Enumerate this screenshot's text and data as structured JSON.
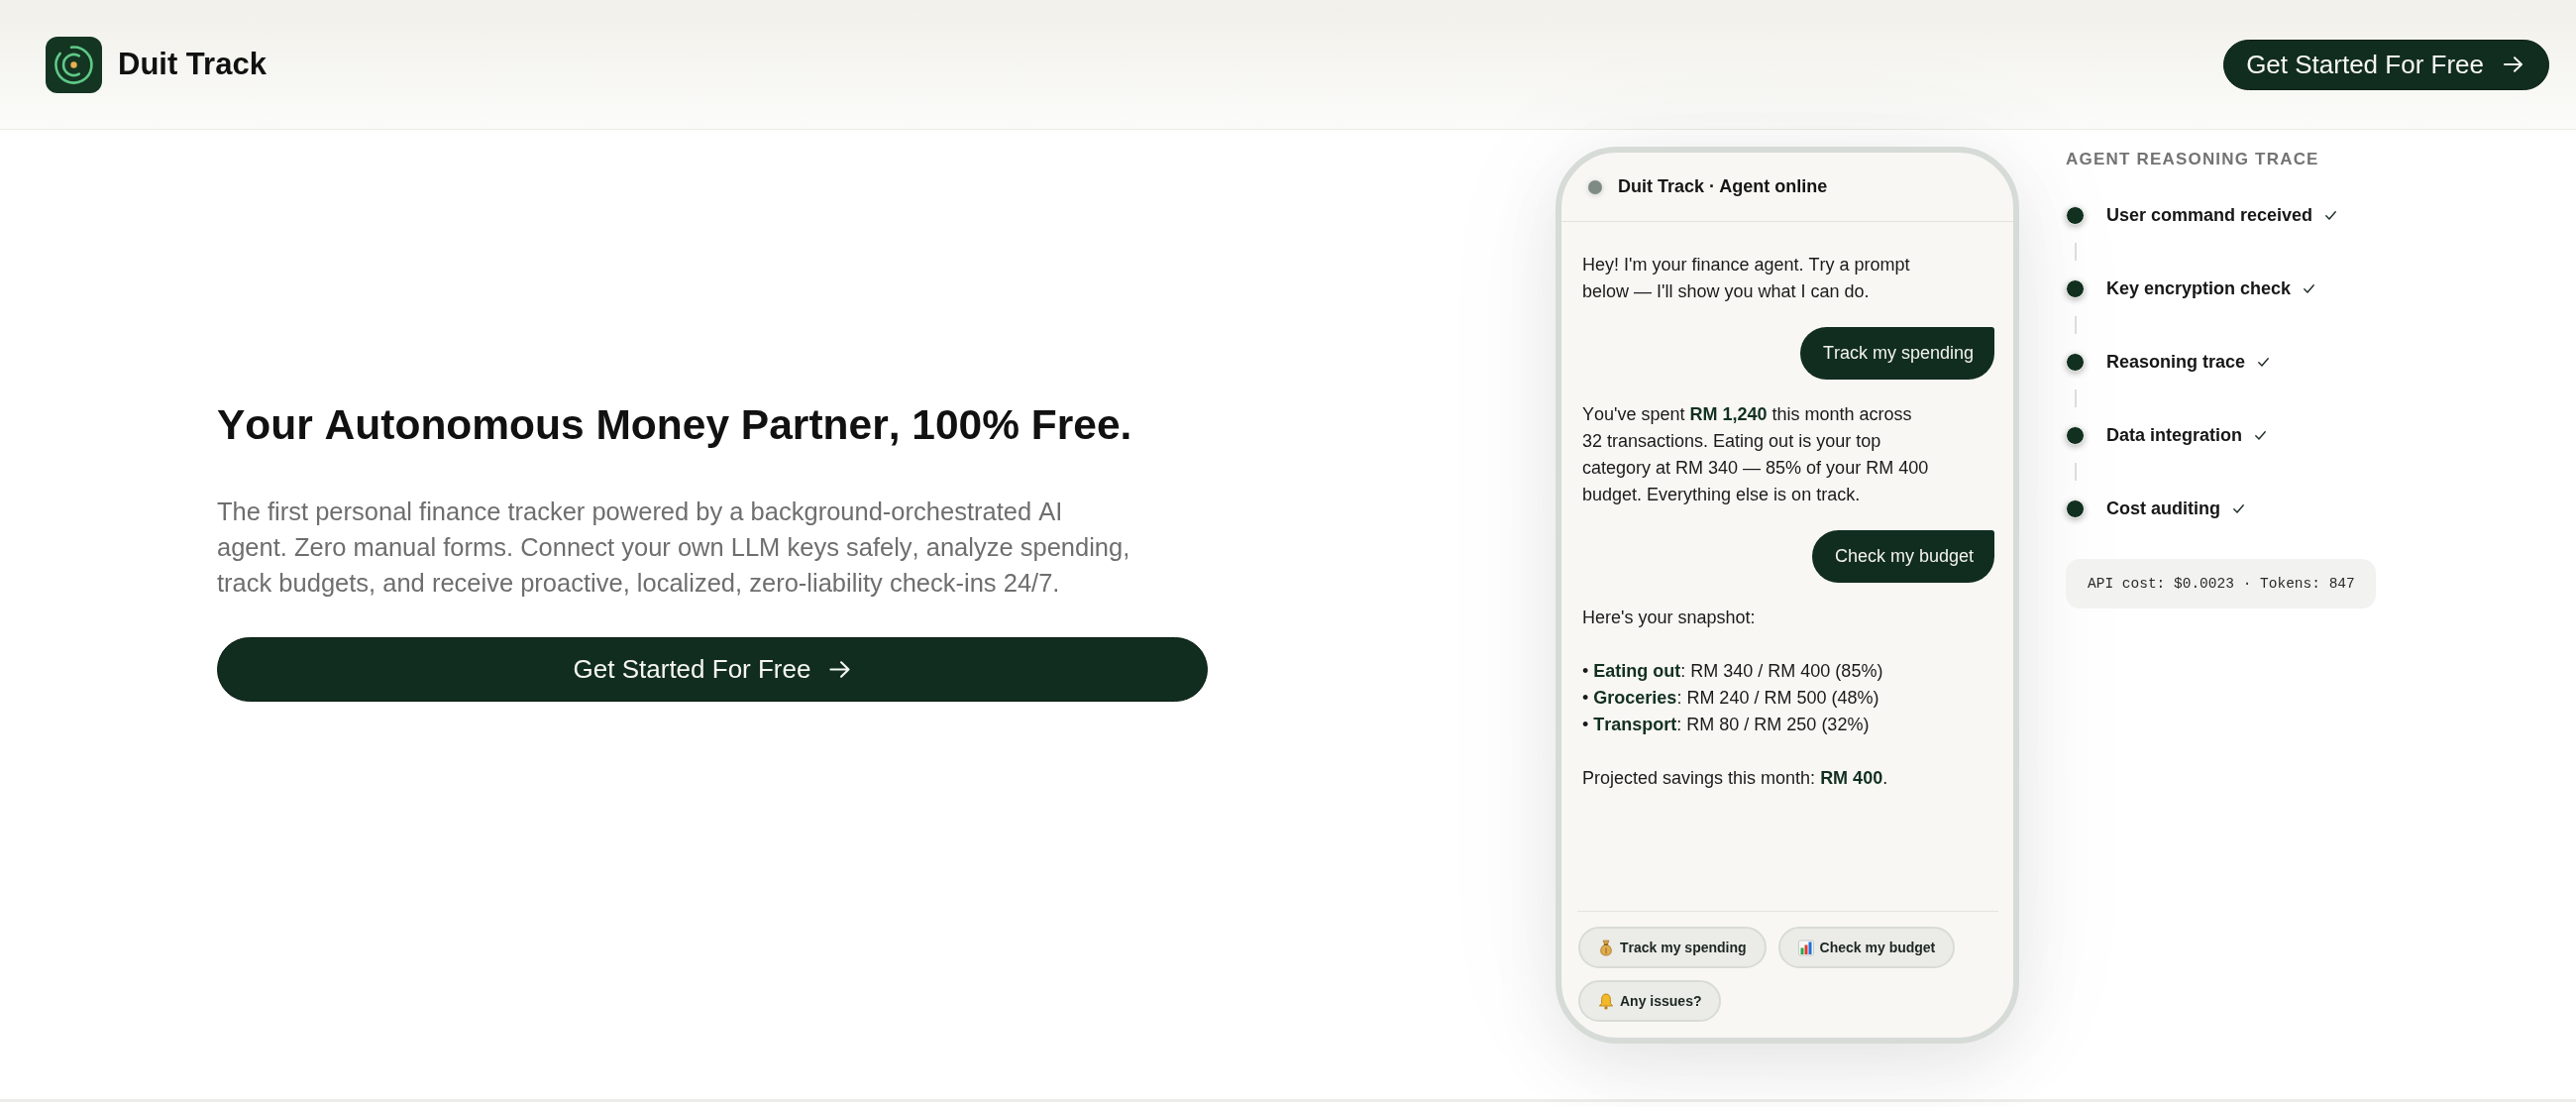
{
  "header": {
    "brand": "Duit Track",
    "cta": "Get Started For Free"
  },
  "hero": {
    "title": "Your Autonomous Money Partner, 100% Free.",
    "description": "The first personal finance tracker powered by a background-orchestrated AI agent. Zero manual forms. Connect your own LLM keys safely, analyze spending, track budgets, and receive proactive, localized, zero-liability check-ins 24/7.",
    "cta": "Get Started For Free"
  },
  "chat": {
    "title": "Duit Track · Agent online",
    "messages": [
      {
        "kind": "agent",
        "paragraphs": [
          {
            "kind": "text",
            "text": "Hey! I'm your finance agent. Try a prompt below — I'll show you what I can do."
          }
        ]
      },
      {
        "kind": "user",
        "text": "Track my spending"
      },
      {
        "kind": "agent",
        "paragraphs": [
          {
            "kind": "text",
            "text": "You've spent **RM 1,240** this month across 32 transactions. Eating out is your top category at RM 340 — 85% of your RM 400 budget. Everything else is on track."
          }
        ]
      },
      {
        "kind": "user",
        "text": "Check my budget"
      },
      {
        "kind": "agent",
        "paragraphs": [
          {
            "kind": "text",
            "text": "Here's your snapshot:"
          },
          {
            "kind": "list",
            "items": [
              "• **Eating out**: RM 340 / RM 400 (85%)",
              "• **Groceries**: RM 240 / RM 500 (48%)",
              "• **Transport**: RM 80 / RM 250 (32%)"
            ]
          },
          {
            "kind": "text",
            "text": "Projected savings this month: **RM 400**."
          }
        ]
      }
    ],
    "suggestions": [
      "Track my spending",
      "Check my budget",
      "Any issues?"
    ]
  },
  "trace": {
    "title": "AGENT REASONING TRACE",
    "steps": [
      {
        "label": "User command received",
        "done": true
      },
      {
        "label": "Key encryption check",
        "done": true
      },
      {
        "label": "Reasoning trace",
        "done": true
      },
      {
        "label": "Data integration",
        "done": true
      },
      {
        "label": "Cost auditing",
        "done": true
      }
    ],
    "cost": "API cost: $0.0023 · Tokens: 847"
  }
}
